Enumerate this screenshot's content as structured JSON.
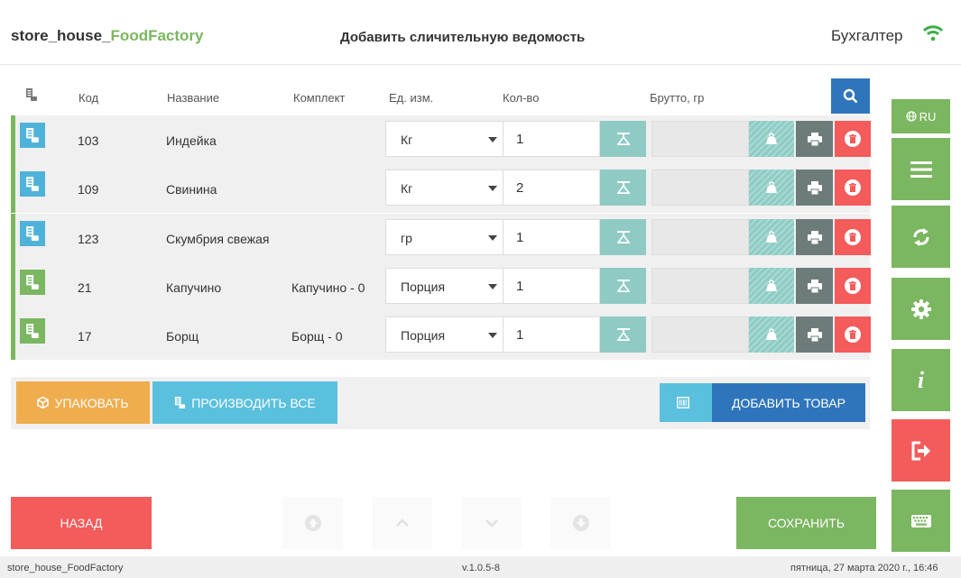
{
  "header": {
    "brand_prefix": "store_house_",
    "brand_accent": "FoodFactory",
    "title": "Добавить сличительную ведомость",
    "user": "Бухгалтер",
    "wifi_icon": "wifi-icon"
  },
  "columns": {
    "code": "Код",
    "name": "Название",
    "kit": "Комплект",
    "unit": "Ед. изм.",
    "qty": "Кол-во",
    "gross": "Брутто, гр"
  },
  "rows": [
    {
      "code": "103",
      "name": "Индейка",
      "kit": "",
      "unit": "Кг",
      "qty": "1",
      "gross": "",
      "icon_color": "#4fb3d9"
    },
    {
      "code": "109",
      "name": "Свинина",
      "kit": "",
      "unit": "Кг",
      "qty": "2",
      "gross": "",
      "icon_color": "#4fb3d9"
    },
    {
      "code": "123",
      "name": "Скумбрия свежая",
      "kit": "",
      "unit": "гр",
      "qty": "1",
      "gross": "",
      "icon_color": "#4fb3d9"
    },
    {
      "code": "21",
      "name": "Капучино",
      "kit": "Капучино - 0",
      "unit": "Порция",
      "qty": "1",
      "gross": "",
      "icon_color": "#7bb660"
    },
    {
      "code": "17",
      "name": "Борщ",
      "kit": "Борщ - 0",
      "unit": "Порция",
      "qty": "1",
      "gross": "",
      "icon_color": "#7bb660"
    }
  ],
  "actions": {
    "pack": "УПАКОВАТЬ",
    "produce_all": "ПРОИЗВОДИТЬ ВСЕ",
    "add_item": "ДОБАВИТЬ ТОВАР"
  },
  "sidebar": {
    "lang": "RU"
  },
  "bottom": {
    "back": "НАЗАД",
    "save": "СОХРАНИТЬ"
  },
  "footer": {
    "app": "store_house_FoodFactory",
    "version": "v.1.0.5-8",
    "datetime": "пятница, 27 марта 2020 г., 16:46"
  },
  "colors": {
    "green": "#7bb660",
    "blue": "#2f75bc",
    "sky": "#4fb3d9",
    "teal": "#8fcbc4",
    "red": "#f45b5b",
    "orange": "#f0ad4e",
    "gray": "#6d7b7b"
  }
}
